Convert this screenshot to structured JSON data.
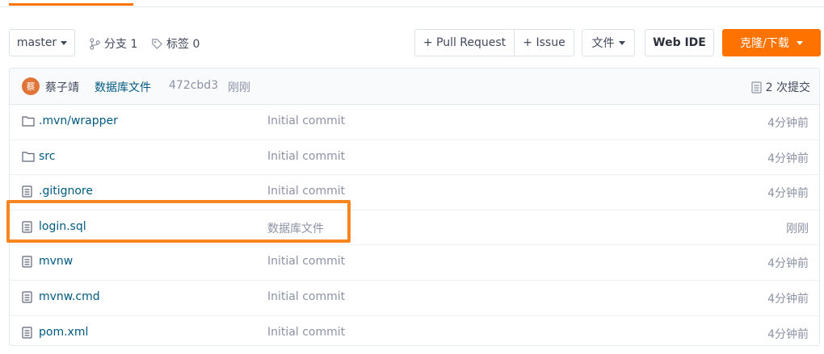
{
  "colors": {
    "accent": "#fe7300",
    "highlight": "#f78520",
    "link": "#005980",
    "muted": "#8c92a4"
  },
  "toolbar": {
    "branch_select": "master",
    "branches_label": "分支 1",
    "tags_label": "标签 0",
    "pull_request_label": "+ Pull Request",
    "issue_label": "+ Issue",
    "files_label": "文件",
    "webide_label": "Web IDE",
    "clone_label": "克隆/下载"
  },
  "commit": {
    "avatar_text": "蔡",
    "author": "蔡子靖",
    "message": "数据库文件",
    "hash": "472cbd3",
    "time": "刚刚",
    "count_label": "2 次提交"
  },
  "files": [
    {
      "type": "folder",
      "name": ".mvn/wrapper",
      "message": "Initial commit",
      "time": "4分钟前"
    },
    {
      "type": "folder",
      "name": "src",
      "message": "Initial commit",
      "time": "4分钟前"
    },
    {
      "type": "file",
      "name": ".gitignore",
      "message": "Initial commit",
      "time": "4分钟前"
    },
    {
      "type": "file",
      "name": "login.sql",
      "message": "数据库文件",
      "time": "刚刚"
    },
    {
      "type": "file",
      "name": "mvnw",
      "message": "Initial commit",
      "time": "4分钟前"
    },
    {
      "type": "file",
      "name": "mvnw.cmd",
      "message": "Initial commit",
      "time": "4分钟前"
    },
    {
      "type": "file",
      "name": "pom.xml",
      "message": "Initial commit",
      "time": "4分钟前"
    }
  ]
}
